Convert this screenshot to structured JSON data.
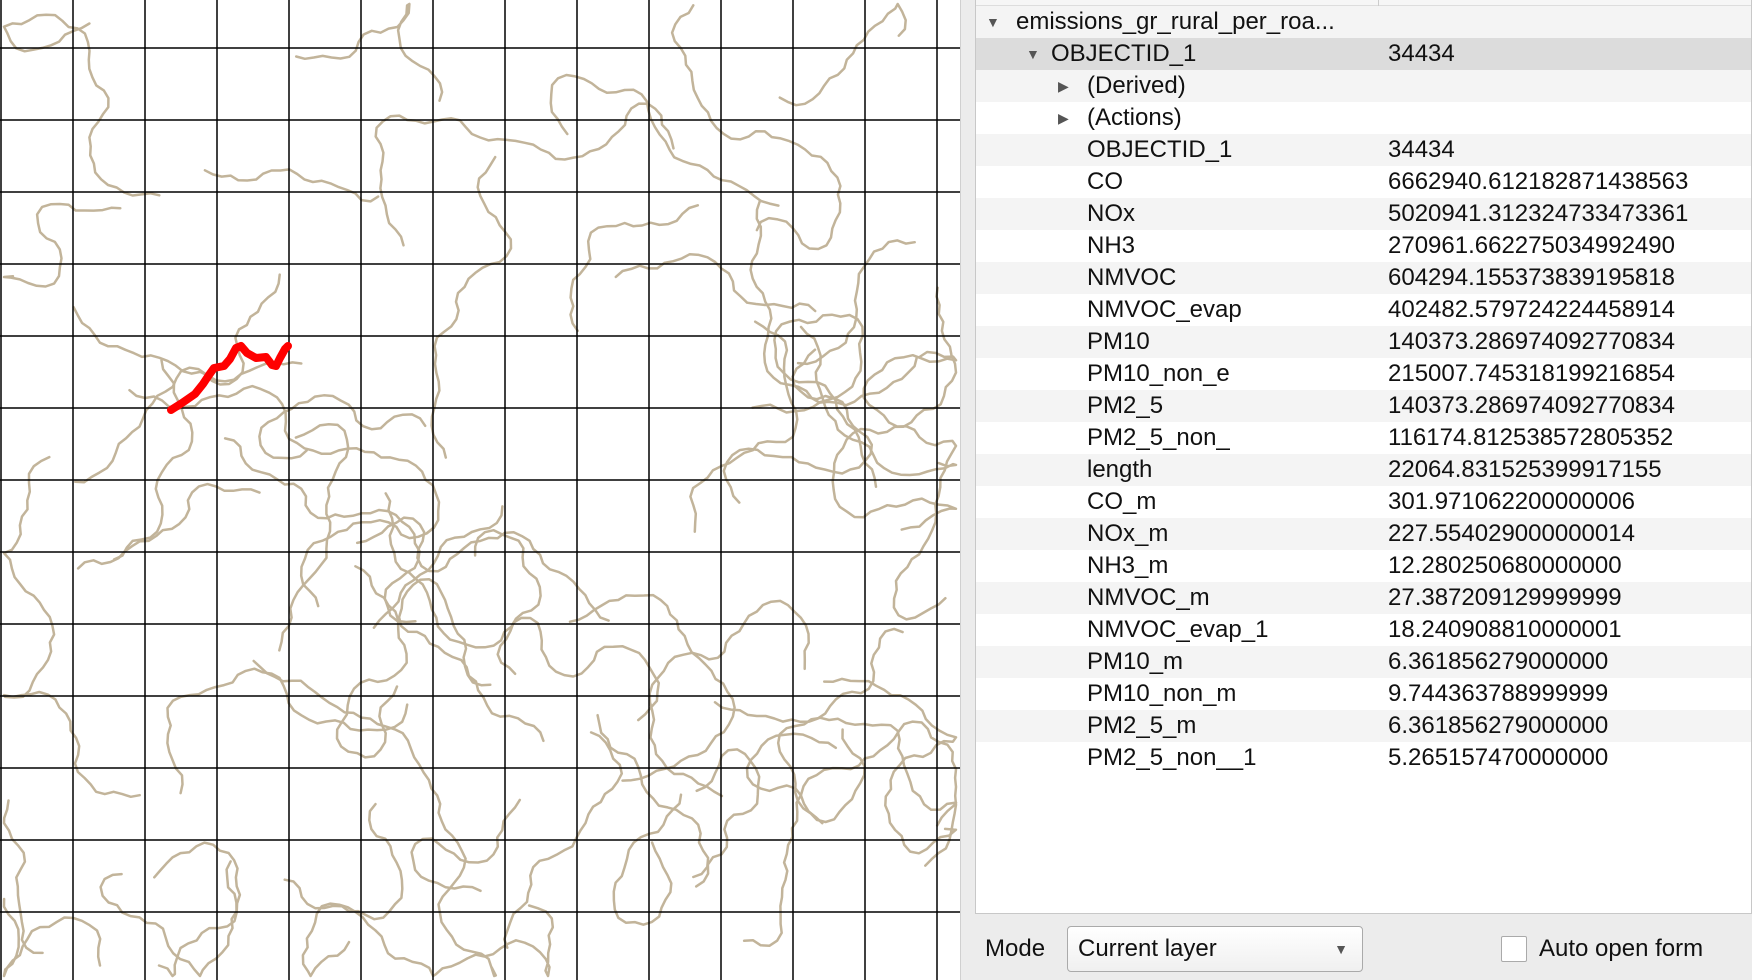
{
  "map": {
    "grid_color": "#000000",
    "road_color": "#c2b49a",
    "selected_color": "#ff0000"
  },
  "tree": {
    "layer": "emissions_gr_rural_per_roa...",
    "feature": {
      "label": "OBJECTID_1",
      "value": "34434"
    },
    "groups": [
      "(Derived)",
      "(Actions)"
    ],
    "attributes": [
      {
        "name": "OBJECTID_1",
        "value": "34434"
      },
      {
        "name": "CO",
        "value": "6662940.612182871438563"
      },
      {
        "name": "NOx",
        "value": "5020941.312324733473361"
      },
      {
        "name": "NH3",
        "value": "270961.662275034992490"
      },
      {
        "name": "NMVOC",
        "value": "604294.155373839195818"
      },
      {
        "name": "NMVOC_evap",
        "value": "402482.579724224458914"
      },
      {
        "name": "PM10",
        "value": "140373.286974092770834"
      },
      {
        "name": "PM10_non_e",
        "value": "215007.745318199216854"
      },
      {
        "name": "PM2_5",
        "value": "140373.286974092770834"
      },
      {
        "name": "PM2_5_non_",
        "value": "116174.812538572805352"
      },
      {
        "name": "length",
        "value": "22064.831525399917155"
      },
      {
        "name": "CO_m",
        "value": "301.971062200000006"
      },
      {
        "name": "NOx_m",
        "value": "227.554029000000014"
      },
      {
        "name": "NH3_m",
        "value": "12.280250680000000"
      },
      {
        "name": "NMVOC_m",
        "value": "27.387209129999999"
      },
      {
        "name": "NMVOC_evap_1",
        "value": "18.240908810000001"
      },
      {
        "name": "PM10_m",
        "value": "6.361856279000000"
      },
      {
        "name": "PM10_non_m",
        "value": "9.744363788999999"
      },
      {
        "name": "PM2_5_m",
        "value": "6.361856279000000"
      },
      {
        "name": "PM2_5_non__1",
        "value": "5.265157470000000"
      }
    ]
  },
  "bottom": {
    "mode_label": "Mode",
    "mode_value": "Current layer",
    "auto_open_label": "Auto open form",
    "auto_open_checked": false
  }
}
